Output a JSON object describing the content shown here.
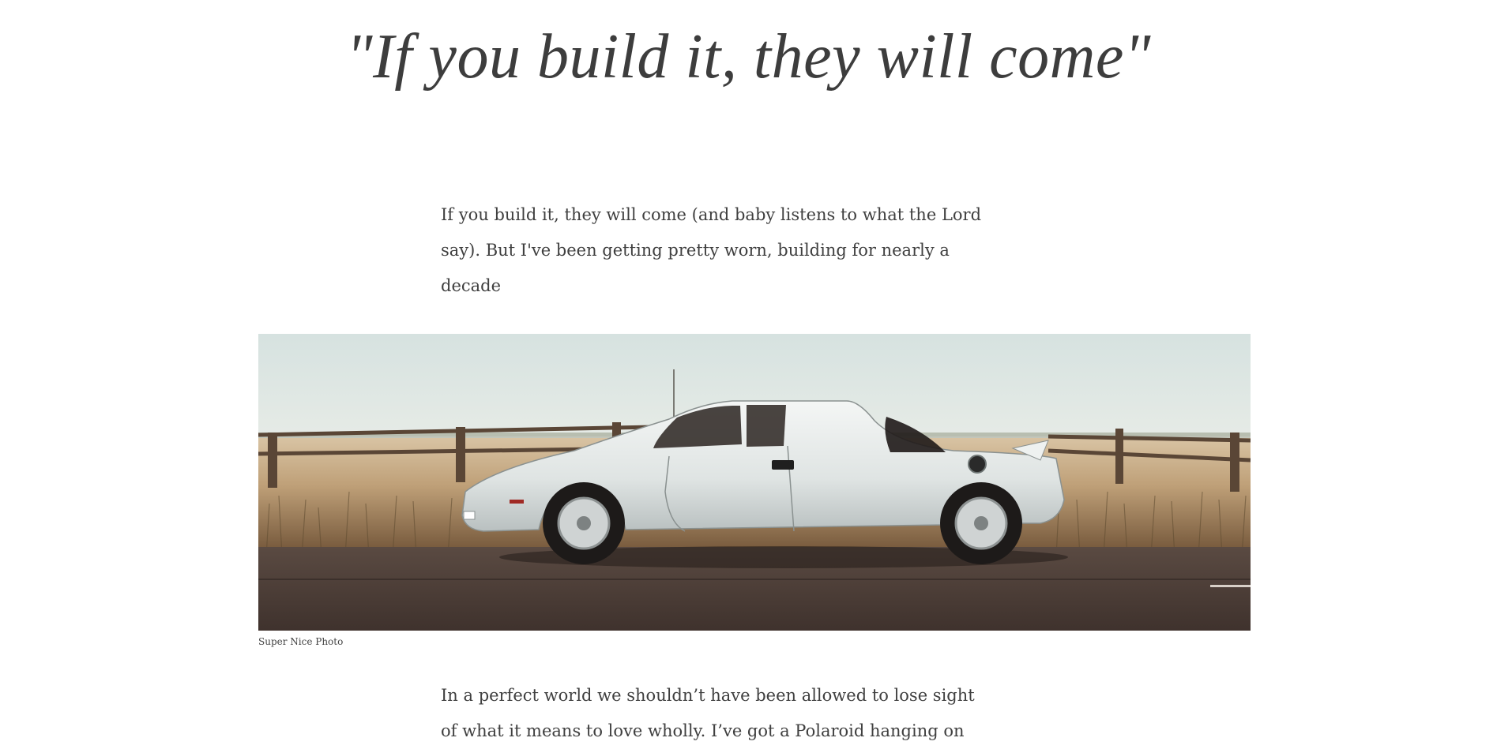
{
  "post": {
    "title": "\"If you build it, they will come\"",
    "intro_paragraph": "If you build it, they will come (and baby listens to what the Lord say). But I've been getting pretty worn, building for nearly a decade",
    "figure": {
      "caption": "Super Nice Photo",
      "image_icon": "white-sports-car-photo"
    },
    "second_paragraph": "In a perfect world we shouldn’t have been allowed to lose sight of what it means to love wholly. I’ve got a Polaroid hanging on"
  },
  "colors": {
    "text": "#3f3f3f",
    "background": "#ffffff"
  }
}
